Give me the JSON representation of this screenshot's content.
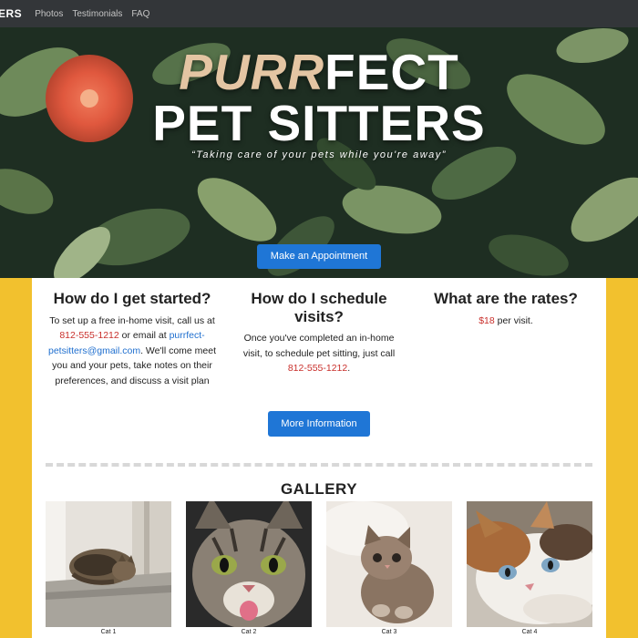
{
  "nav": {
    "brand": "ERS",
    "links": [
      "Photos",
      "Testimonials",
      "FAQ"
    ]
  },
  "hero": {
    "title_accent": "PURR",
    "title_rest": "FECT",
    "title_line2": "PET SITTERS",
    "tagline": "“Taking care of your pets while you're away”",
    "cta_label": "Make an Appointment"
  },
  "info": {
    "started": {
      "heading": "How do I get started?",
      "text_a": "To set up a free in-home visit, call us at ",
      "phone": "812-555-1212",
      "text_b": " or email at ",
      "email": "purrfect-petsitters@gmail.com",
      "text_c": ". We'll come meet you and your pets, take notes on their preferences, and discuss a visit plan"
    },
    "schedule": {
      "heading": "How do I schedule visits?",
      "text_a": "Once you've completed an in-home visit, to schedule pet sitting, just call ",
      "phone": "812-555-1212",
      "text_b": "."
    },
    "rates": {
      "heading": "What are the rates?",
      "price": "$18",
      "text": " per visit."
    },
    "more_label": "More Information"
  },
  "gallery": {
    "title": "GALLERY",
    "captions": [
      "Cat 1",
      "Cat 2",
      "Cat 3",
      "Cat 4"
    ]
  },
  "colors": {
    "nav_bg": "#333639",
    "accent_yellow": "#f2c12e",
    "button_blue": "#1f76d6",
    "link_red": "#c9302c",
    "title_accent": "#e4c5a3"
  }
}
